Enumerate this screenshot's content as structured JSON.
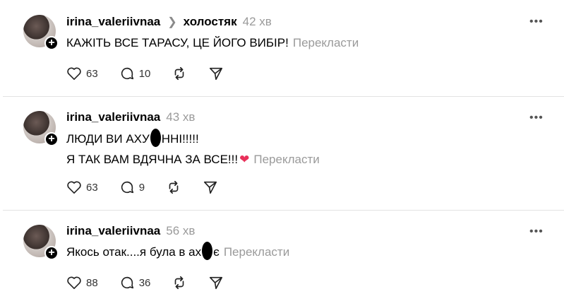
{
  "posts": [
    {
      "username": "irina_valeriivnaa",
      "topic": "холостяк",
      "time": "42 хв",
      "lines": [
        "КАЖІТЬ ВСЕ ТАРАСУ, ЦЕ ЙОГО ВИБІР!"
      ],
      "translate": "Перекласти",
      "likes": "63",
      "replies": "10"
    },
    {
      "username": "irina_valeriivnaa",
      "time": "43 хв",
      "line1_a": "ЛЮДИ ВИ АХУ",
      "line1_b": "ННІ!!!!!",
      "line2": "Я ТАК ВАМ ВДЯЧНА ЗА ВСЕ!!!",
      "translate": "Перекласти",
      "likes": "63",
      "replies": "9"
    },
    {
      "username": "irina_valeriivnaa",
      "time": "56 хв",
      "text_a": "Якось отак....я була в ах",
      "text_b": "є",
      "translate": "Перекласти",
      "likes": "88",
      "replies": "36"
    }
  ],
  "icons": {
    "more": "more-horizontal-icon",
    "like": "heart-outline-icon",
    "reply": "comment-bubble-icon",
    "repost": "repost-icon",
    "share": "send-icon",
    "follow": "plus-icon"
  },
  "colors": {
    "muted": "#9a9a9a",
    "divider": "#e3e3e3",
    "heart": "#e8305a"
  }
}
